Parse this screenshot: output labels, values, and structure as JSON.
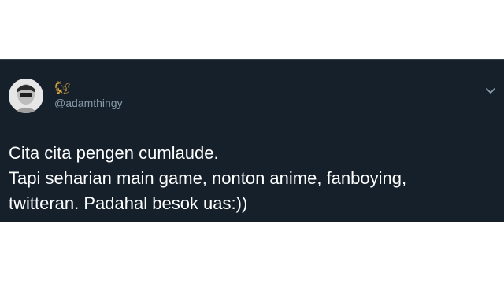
{
  "tweet": {
    "display_name": "🐿",
    "handle": "@adamthingy",
    "text_lines": [
      "Cita cita pengen cumlaude.",
      "Tapi seharian main game, nonton anime, fanboying,",
      "twitteran. Padahal besok uas:))"
    ]
  },
  "icons": {
    "avatar": "avatar",
    "menu": "chevron-down-icon"
  },
  "colors": {
    "background": "#15202b",
    "text": "#ffffff",
    "secondary_text": "#8899a6",
    "border": "#38444d"
  }
}
